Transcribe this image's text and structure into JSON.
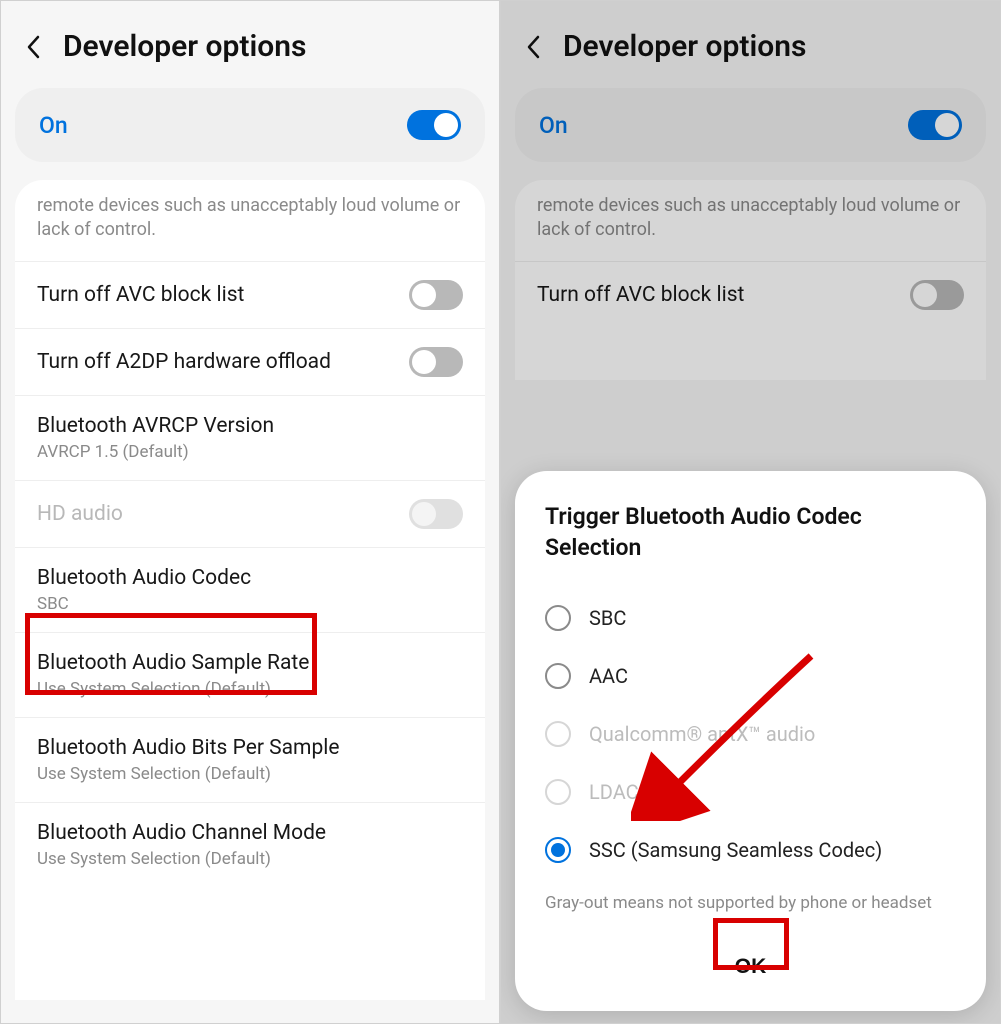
{
  "left": {
    "header": {
      "title": "Developer options"
    },
    "on_row": {
      "label": "On",
      "enabled": true
    },
    "description": "remote devices such as unacceptably loud volume or lack of control.",
    "rows": {
      "avc": {
        "title": "Turn off AVC block list"
      },
      "a2dp": {
        "title": "Turn off A2DP hardware offload"
      },
      "avrcp": {
        "title": "Bluetooth AVRCP Version",
        "sub": "AVRCP 1.5 (Default)"
      },
      "hd_audio": {
        "title": "HD audio"
      },
      "codec": {
        "title": "Bluetooth Audio Codec",
        "sub": "SBC"
      },
      "sample_rate": {
        "title": "Bluetooth Audio Sample Rate",
        "sub": "Use System Selection (Default)"
      },
      "bits": {
        "title": "Bluetooth Audio Bits Per Sample",
        "sub": "Use System Selection (Default)"
      },
      "channel": {
        "title": "Bluetooth Audio Channel Mode",
        "sub": "Use System Selection (Default)"
      }
    }
  },
  "right": {
    "header": {
      "title": "Developer options"
    },
    "on_row": {
      "label": "On",
      "enabled": true
    },
    "description": "remote devices such as unacceptably loud volume or lack of control.",
    "rows": {
      "avc": {
        "title": "Turn off AVC block list"
      }
    },
    "dialog": {
      "title": "Trigger Bluetooth Audio Codec Selection",
      "options": {
        "sbc": "SBC",
        "aac": "AAC",
        "aptx": "Qualcomm® aptX™ audio",
        "ldac": "LDAC",
        "ssc": "SSC (Samsung Seamless Codec)"
      },
      "note": "Gray-out means not supported by phone or headset",
      "ok": "OK"
    }
  }
}
